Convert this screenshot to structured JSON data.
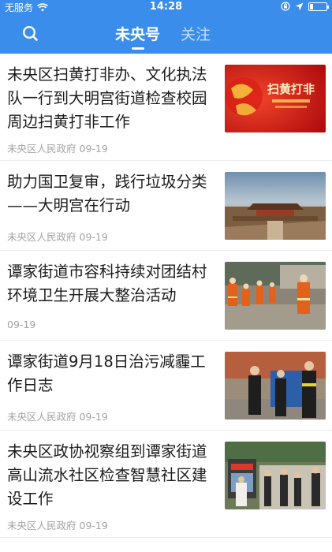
{
  "status": {
    "carrier": "无服务",
    "time": "14:28"
  },
  "nav": {
    "tabs": [
      {
        "label": "未央号",
        "active": true
      },
      {
        "label": "关注",
        "active": false
      }
    ]
  },
  "articles": [
    {
      "title": "未央区扫黄打非办、文化执法队一行到大明宫街道检查校园周边扫黄打非工作",
      "source": "未央区人民政府",
      "date": "09-19",
      "thumb_text": "扫黄打非"
    },
    {
      "title": "助力国卫复审，践行垃圾分类——大明宫在行动",
      "source": "未央区人民政府",
      "date": "09-19"
    },
    {
      "title": "谭家街道市容科持续对团结村环境卫生开展大整治活动",
      "source": "",
      "date": "09-19"
    },
    {
      "title": "谭家街道9月18日治污减霾工作日志",
      "source": "未央区人民政府",
      "date": "09-19"
    },
    {
      "title": "未央区政协视察组到谭家街道高山流水社区检查智慧社区建设工作",
      "source": "未央区人民政府",
      "date": "09-19"
    }
  ],
  "colors": {
    "header": "#3a8dea",
    "meta_text": "#a3a3a3"
  }
}
